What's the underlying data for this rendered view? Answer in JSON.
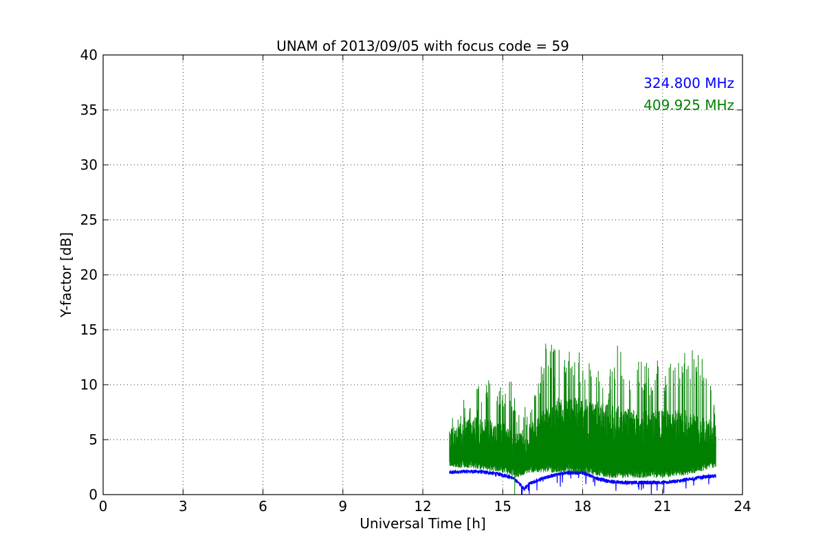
{
  "chart_data": {
    "type": "line",
    "title": "UNAM of 2013/09/05 with focus code = 59",
    "xlabel": "Universal Time [h]",
    "ylabel": "Y-factor [dB]",
    "xlim": [
      0,
      24
    ],
    "ylim": [
      0,
      40
    ],
    "xticks": [
      0,
      3,
      6,
      9,
      12,
      15,
      18,
      21,
      24
    ],
    "yticks": [
      0,
      5,
      10,
      15,
      20,
      25,
      30,
      35,
      40
    ],
    "grid": true,
    "legend_position": "top-right",
    "series": [
      {
        "name": "324.800 MHz",
        "color": "#0000ff",
        "baseline": [
          [
            13.0,
            2.0
          ],
          [
            13.5,
            2.1
          ],
          [
            14.0,
            2.1
          ],
          [
            14.5,
            2.0
          ],
          [
            15.0,
            1.8
          ],
          [
            15.3,
            1.6
          ],
          [
            15.5,
            1.3
          ],
          [
            15.7,
            0.8
          ],
          [
            15.8,
            0.5
          ],
          [
            16.0,
            1.0
          ],
          [
            16.5,
            1.5
          ],
          [
            17.0,
            1.8
          ],
          [
            17.5,
            2.0
          ],
          [
            18.0,
            2.0
          ],
          [
            18.5,
            1.5
          ],
          [
            19.0,
            1.2
          ],
          [
            19.5,
            1.1
          ],
          [
            20.0,
            1.1
          ],
          [
            20.5,
            1.1
          ],
          [
            21.0,
            1.1
          ],
          [
            21.5,
            1.2
          ],
          [
            22.0,
            1.4
          ],
          [
            22.5,
            1.6
          ],
          [
            23.0,
            1.7
          ]
        ]
      },
      {
        "name": "409.925 MHz",
        "color": "#008000",
        "lower": [
          [
            13.0,
            2.5
          ],
          [
            14.0,
            2.3
          ],
          [
            15.0,
            2.0
          ],
          [
            15.5,
            1.5
          ],
          [
            16.0,
            2.0
          ],
          [
            17.0,
            2.0
          ],
          [
            18.0,
            2.0
          ],
          [
            19.0,
            1.5
          ],
          [
            20.0,
            1.5
          ],
          [
            21.0,
            1.5
          ],
          [
            22.0,
            1.8
          ],
          [
            23.0,
            2.5
          ]
        ],
        "upper": [
          [
            13.0,
            6.5
          ],
          [
            13.5,
            9.0
          ],
          [
            14.0,
            10.0
          ],
          [
            14.5,
            10.5
          ],
          [
            15.0,
            10.0
          ],
          [
            15.2,
            11.5
          ],
          [
            15.5,
            8.5
          ],
          [
            16.0,
            8.0
          ],
          [
            16.5,
            13.0
          ],
          [
            16.7,
            14.3
          ],
          [
            17.0,
            13.5
          ],
          [
            17.5,
            13.0
          ],
          [
            18.0,
            13.0
          ],
          [
            18.5,
            11.5
          ],
          [
            19.0,
            11.0
          ],
          [
            19.3,
            14.2
          ],
          [
            19.5,
            13.0
          ],
          [
            20.0,
            12.5
          ],
          [
            20.5,
            12.0
          ],
          [
            21.0,
            12.5
          ],
          [
            21.5,
            12.5
          ],
          [
            22.0,
            13.5
          ],
          [
            22.5,
            13.0
          ],
          [
            23.0,
            8.0
          ]
        ],
        "typical_top": [
          [
            13.0,
            5.5
          ],
          [
            14.0,
            6.5
          ],
          [
            15.0,
            6.0
          ],
          [
            15.5,
            5.0
          ],
          [
            16.0,
            6.0
          ],
          [
            17.0,
            8.0
          ],
          [
            18.0,
            8.0
          ],
          [
            19.0,
            7.5
          ],
          [
            20.0,
            7.0
          ],
          [
            21.0,
            7.0
          ],
          [
            22.0,
            7.0
          ],
          [
            23.0,
            6.0
          ]
        ],
        "dip": [
          15.45,
          0
        ]
      }
    ]
  }
}
